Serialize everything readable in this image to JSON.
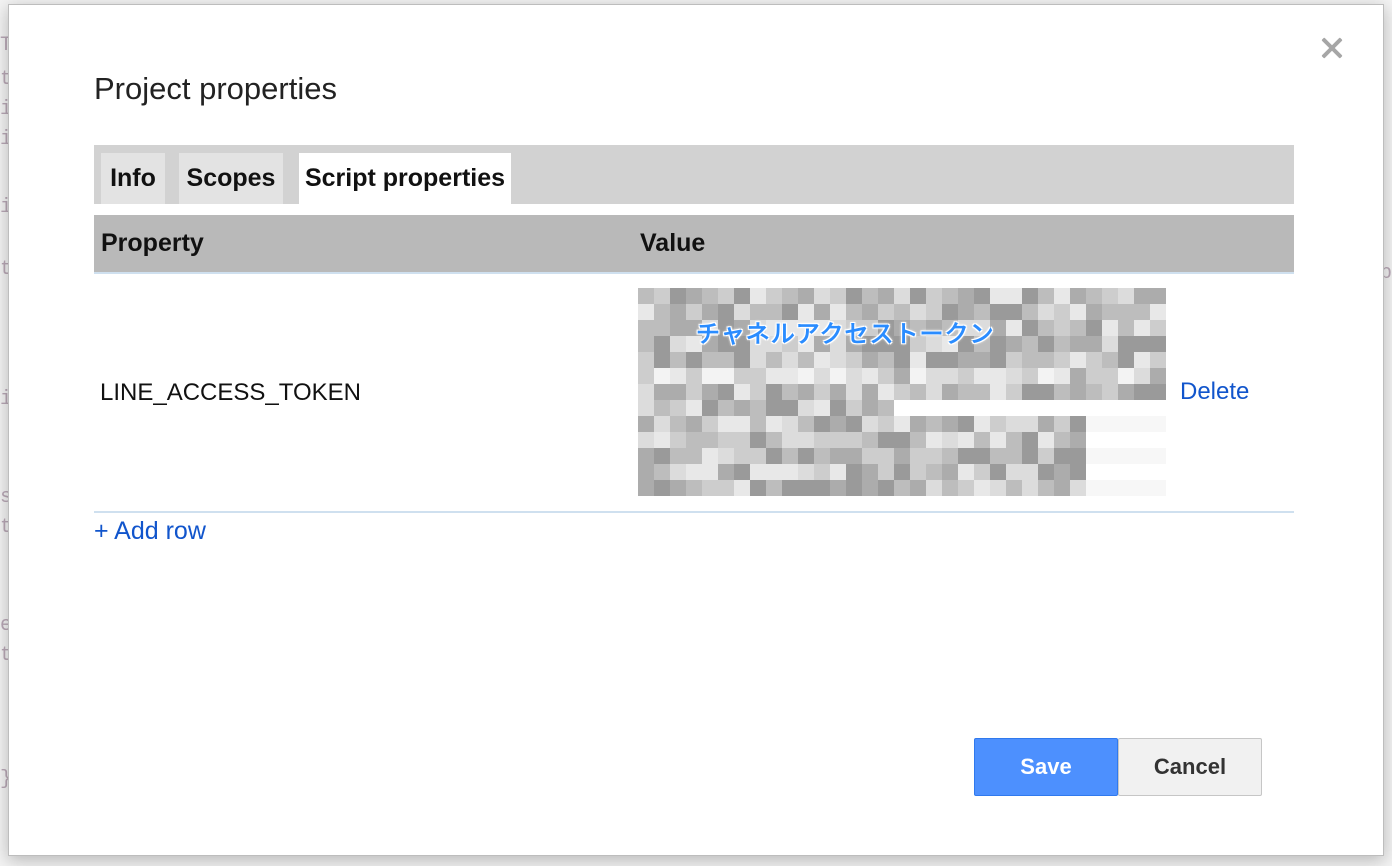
{
  "dialog": {
    "title": "Project properties",
    "close_icon": "close-icon"
  },
  "tabs": [
    {
      "label": "Info",
      "active": false
    },
    {
      "label": "Scopes",
      "active": false
    },
    {
      "label": "Script properties",
      "active": true
    }
  ],
  "table": {
    "headers": {
      "property": "Property",
      "value": "Value"
    },
    "rows": [
      {
        "property": "LINE_ACCESS_TOKEN",
        "value_overlay": "チャネルアクセストークン",
        "delete_label": "Delete"
      }
    ]
  },
  "add_row_label": "+ Add row",
  "buttons": {
    "save": "Save",
    "cancel": "Cancel"
  },
  "colors": {
    "accent": "#4d90fe",
    "link": "#1155cc",
    "tab_bar": "#d2d2d2",
    "header": "#b9b9b9"
  }
}
